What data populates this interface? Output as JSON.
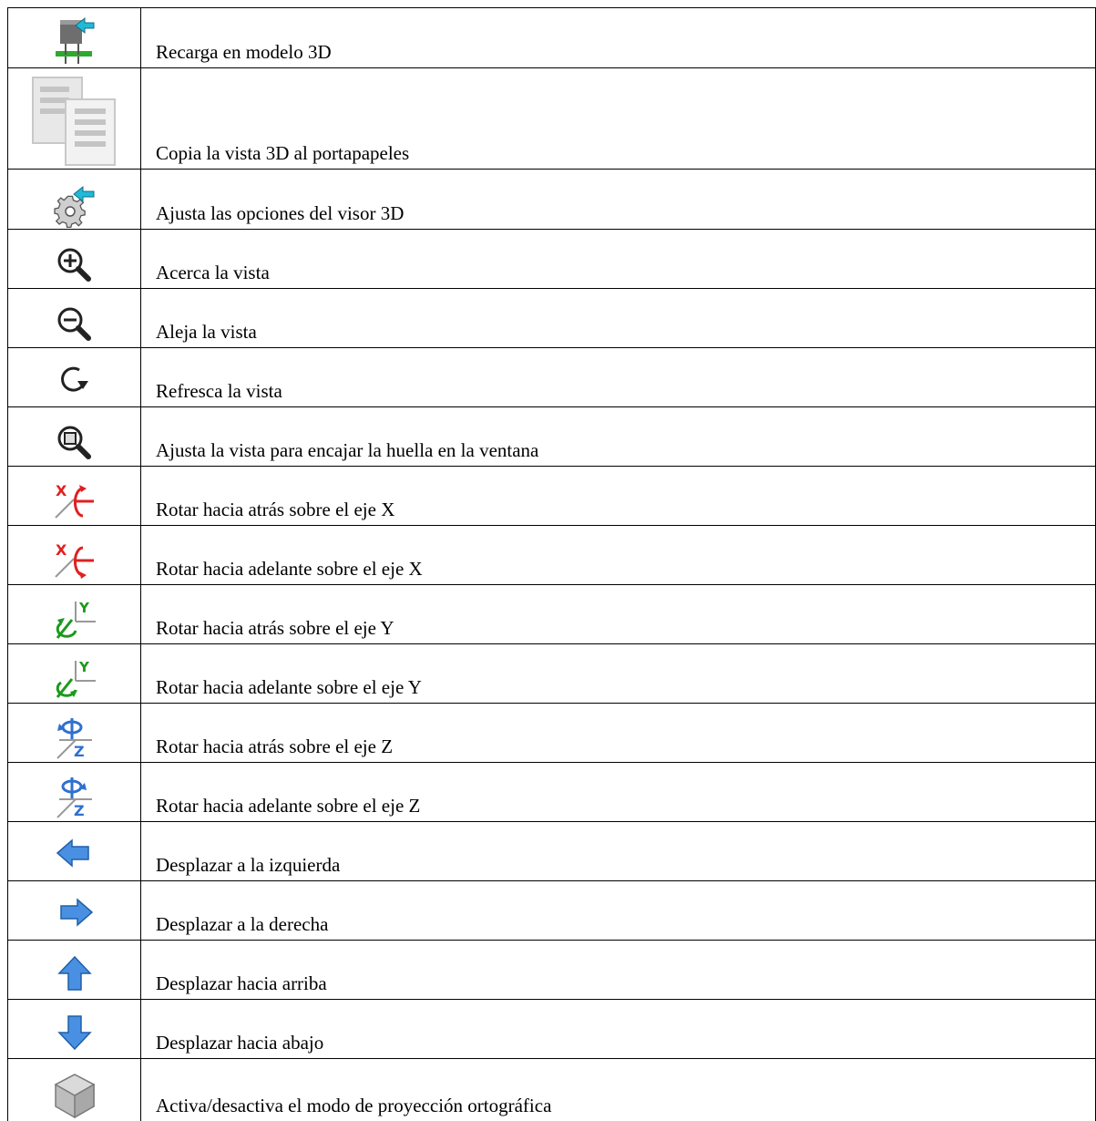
{
  "rows": [
    {
      "icon": "reload-3d-model-icon",
      "label": "Recarga en modelo 3D"
    },
    {
      "icon": "copy-to-clipboard-icon",
      "label": "Copia la vista 3D al portapapeles"
    },
    {
      "icon": "settings-gear-icon",
      "label": "Ajusta las opciones del visor 3D"
    },
    {
      "icon": "zoom-in-icon",
      "label": "Acerca la vista"
    },
    {
      "icon": "zoom-out-icon",
      "label": "Aleja la vista"
    },
    {
      "icon": "refresh-icon",
      "label": "Refresca la vista"
    },
    {
      "icon": "zoom-fit-icon",
      "label": "Ajusta la vista para encajar la huella en la ventana"
    },
    {
      "icon": "rotate-x-back-icon",
      "label": "Rotar hacia atrás sobre el eje X"
    },
    {
      "icon": "rotate-x-forward-icon",
      "label": "Rotar hacia adelante sobre el eje X"
    },
    {
      "icon": "rotate-y-back-icon",
      "label": "Rotar hacia atrás sobre el eje Y"
    },
    {
      "icon": "rotate-y-forward-icon",
      "label": "Rotar hacia adelante sobre el eje Y"
    },
    {
      "icon": "rotate-z-back-icon",
      "label": "Rotar hacia atrás sobre el eje Z"
    },
    {
      "icon": "rotate-z-forward-icon",
      "label": "Rotar hacia adelante sobre el eje Z"
    },
    {
      "icon": "pan-left-icon",
      "label": "Desplazar a la izquierda"
    },
    {
      "icon": "pan-right-icon",
      "label": "Desplazar a la derecha"
    },
    {
      "icon": "pan-up-icon",
      "label": "Desplazar hacia arriba"
    },
    {
      "icon": "pan-down-icon",
      "label": "Desplazar hacia abajo"
    },
    {
      "icon": "orthographic-toggle-icon",
      "label": "Activa/desactiva el modo de proyección ortográfica"
    }
  ],
  "colors": {
    "border": "#000000",
    "arrow_blue": "#4a90e2",
    "rotate_red": "#e02020",
    "rotate_green": "#1a9a1a",
    "rotate_blue": "#2f6fd0",
    "cyan_arrow": "#22b8d8"
  }
}
